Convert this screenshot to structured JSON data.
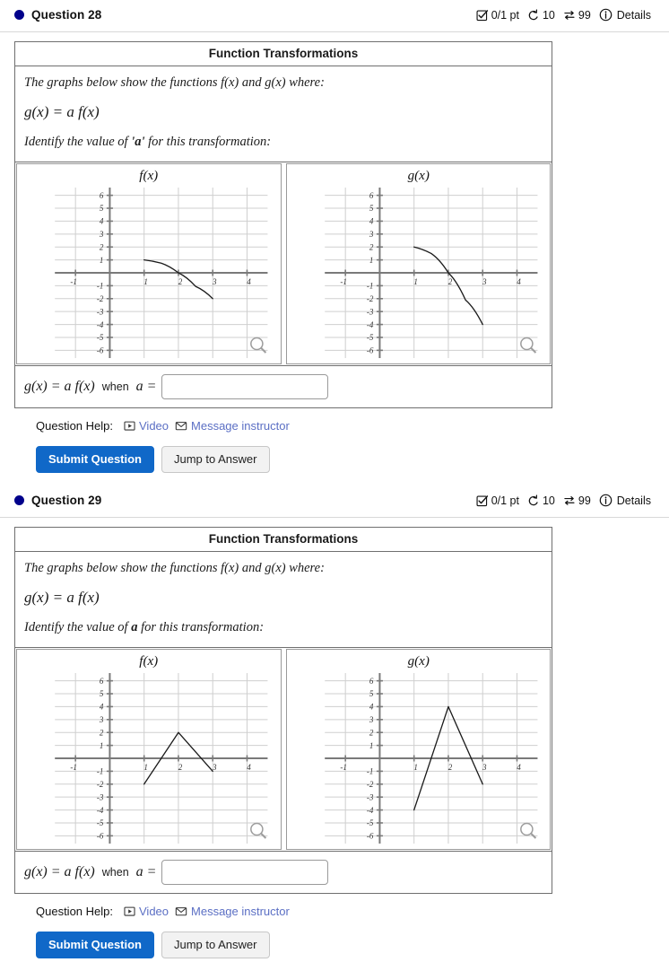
{
  "questions": [
    {
      "bullet_color": "#00008b",
      "title": "Question 28",
      "meta": {
        "points": "0/1 pt",
        "attempts": "10",
        "versions": "99",
        "details_label": "Details",
        "icons": {
          "points": "checkbox-check-icon",
          "attempts": "undo-retry-icon",
          "versions": "swap-arrows-icon",
          "details": "info-circle-icon"
        }
      },
      "card": {
        "title": "Function Transformations",
        "line1": "The graphs below show the functions f(x) and g(x) where:",
        "equation": "g(x) = a f(x)",
        "line2_prefix": "Identify the value of ",
        "line2_emph": "'a'",
        "line2_suffix": " for this transformation:"
      },
      "graphs": [
        {
          "label": "f(x)",
          "zoom_icon": "magnifier-icon",
          "chart_ref": 0
        },
        {
          "label": "g(x)",
          "zoom_icon": "magnifier-icon",
          "chart_ref": 1
        }
      ],
      "answer": {
        "equation": "g(x) = a f(x)",
        "when_word": "when",
        "var_eq": "a =",
        "value": "",
        "placeholder": ""
      },
      "help": {
        "label": "Question Help:",
        "video_label": "Video",
        "video_icon": "video-play-icon",
        "message_label": "Message instructor",
        "message_icon": "envelope-icon"
      },
      "buttons": {
        "submit": "Submit Question",
        "jump": "Jump to Answer"
      }
    },
    {
      "bullet_color": "#00008b",
      "title": "Question 29",
      "meta": {
        "points": "0/1 pt",
        "attempts": "10",
        "versions": "99",
        "details_label": "Details",
        "icons": {
          "points": "checkbox-check-icon",
          "attempts": "undo-retry-icon",
          "versions": "swap-arrows-icon",
          "details": "info-circle-icon"
        }
      },
      "card": {
        "title": "Function Transformations",
        "line1": "The graphs below show the functions f(x) and g(x) where:",
        "equation": "g(x) = a f(x)",
        "line2_prefix": "Identify the value of ",
        "line2_emph": "a",
        "line2_suffix": " for this transformation:"
      },
      "graphs": [
        {
          "label": "f(x)",
          "zoom_icon": "magnifier-icon",
          "chart_ref": 2
        },
        {
          "label": "g(x)",
          "zoom_icon": "magnifier-icon",
          "chart_ref": 3
        }
      ],
      "answer": {
        "equation": "g(x) = a f(x)",
        "when_word": "when",
        "var_eq": "a =",
        "value": "",
        "placeholder": ""
      },
      "help": {
        "label": "Question Help:",
        "video_label": "Video",
        "video_icon": "video-play-icon",
        "message_label": "Message instructor",
        "message_icon": "envelope-icon"
      },
      "buttons": {
        "submit": "Submit Question",
        "jump": "Jump to Answer"
      }
    }
  ],
  "chart_data": [
    {
      "type": "line",
      "title": "f(x)",
      "xlabel": "",
      "ylabel": "",
      "xlim": [
        -1.6,
        4.6
      ],
      "ylim": [
        -6.6,
        6.6
      ],
      "xticks": [
        -1,
        1,
        2,
        3,
        4
      ],
      "yticks": [
        6,
        5,
        4,
        3,
        2,
        1,
        -1,
        -2,
        -3,
        -4,
        -5,
        -6
      ],
      "grid": true,
      "series": [
        {
          "name": "f(x)",
          "points": [
            [
              1,
              1
            ],
            [
              1.5,
              0.75
            ],
            [
              2,
              0
            ],
            [
              2.5,
              -1.05
            ],
            [
              3,
              -2
            ]
          ],
          "shape": "concave-down-curve"
        }
      ]
    },
    {
      "type": "line",
      "title": "g(x)",
      "xlabel": "",
      "ylabel": "",
      "xlim": [
        -1.6,
        4.6
      ],
      "ylim": [
        -6.6,
        6.6
      ],
      "xticks": [
        -1,
        1,
        2,
        3,
        4
      ],
      "yticks": [
        6,
        5,
        4,
        3,
        2,
        1,
        -1,
        -2,
        -3,
        -4,
        -5,
        -6
      ],
      "grid": true,
      "series": [
        {
          "name": "g(x)",
          "points": [
            [
              1,
              2
            ],
            [
              1.5,
              1.5
            ],
            [
              2,
              0
            ],
            [
              2.5,
              -2.1
            ],
            [
              3,
              -4
            ]
          ],
          "shape": "concave-down-curve"
        }
      ]
    },
    {
      "type": "line",
      "title": "f(x)",
      "xlabel": "",
      "ylabel": "",
      "xlim": [
        -1.6,
        4.6
      ],
      "ylim": [
        -6.6,
        6.6
      ],
      "xticks": [
        -1,
        1,
        2,
        3,
        4
      ],
      "yticks": [
        6,
        5,
        4,
        3,
        2,
        1,
        -1,
        -2,
        -3,
        -4,
        -5,
        -6
      ],
      "grid": true,
      "series": [
        {
          "name": "f(x)",
          "points": [
            [
              1,
              -2
            ],
            [
              2,
              2
            ],
            [
              3,
              -1
            ]
          ],
          "shape": "piecewise-linear"
        }
      ]
    },
    {
      "type": "line",
      "title": "g(x)",
      "xlabel": "",
      "ylabel": "",
      "xlim": [
        -1.6,
        4.6
      ],
      "ylim": [
        -6.6,
        6.6
      ],
      "xticks": [
        -1,
        1,
        2,
        3,
        4
      ],
      "yticks": [
        6,
        5,
        4,
        3,
        2,
        1,
        -1,
        -2,
        -3,
        -4,
        -5,
        -6
      ],
      "grid": true,
      "series": [
        {
          "name": "g(x)",
          "points": [
            [
              1,
              -4
            ],
            [
              2,
              4
            ],
            [
              3,
              -2
            ]
          ],
          "shape": "piecewise-linear"
        }
      ]
    }
  ],
  "colors": {
    "accent": "#1068c8",
    "link": "#5b6fc4",
    "bullet": "#00008b",
    "card_border": "#6f6f6f",
    "grid": "#cfcfcf",
    "axis": "#7a7a7a",
    "curve": "#1a1a1a",
    "tick_label": "#333333"
  }
}
